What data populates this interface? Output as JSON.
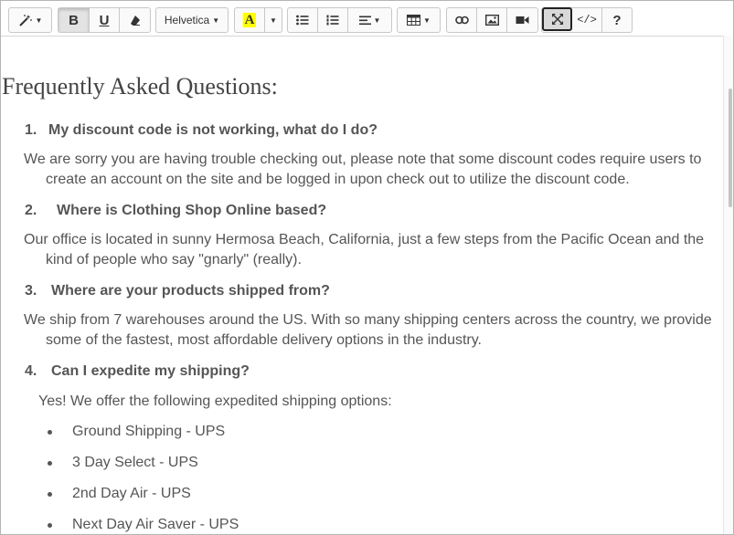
{
  "toolbar": {
    "font_name": "Helvetica",
    "bold": "B",
    "underline": "U",
    "highlight_letter": "A",
    "code": "</>",
    "help": "?"
  },
  "content": {
    "heading": "Frequently Asked Questions:",
    "faqs": [
      {
        "number": "1.",
        "question": "My discount code is not working, what do I do?",
        "answer_line1": "We are sorry you are having trouble checking out, please note that some discount codes require users to",
        "answer_line2": "create an account on the site and be logged in upon check out to utilize the discount code."
      },
      {
        "number": "2.",
        "question": "Where is Clothing Shop Online based?",
        "answer_line1": "Our office is located in sunny Hermosa Beach, California, just a few steps from the Pacific Ocean and the",
        "answer_line2": "kind of people who say \"gnarly\" (really)."
      },
      {
        "number": "3.",
        "question": "Where are your products shipped from?",
        "answer_line1": "We ship from 7 warehouses around the US. With so many shipping centers across the country, we provide",
        "answer_line2": "some of the fastest, most affordable delivery options in the industry."
      },
      {
        "number": "4.",
        "question": "Can I expedite my shipping?",
        "answer_line1": "Yes! We offer the following expedited shipping options:"
      }
    ],
    "shipping_options": [
      "Ground Shipping - UPS",
      "3 Day Select - UPS",
      "2nd Day Air - UPS",
      "Next Day Air Saver - UPS"
    ]
  }
}
